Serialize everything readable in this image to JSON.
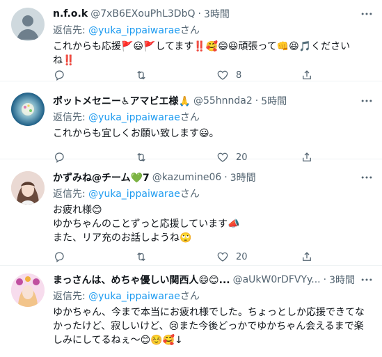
{
  "tweets": [
    {
      "name": "n.f.o.k",
      "handle": "@7xB6EXouPhL3DbQ",
      "time": "3時間",
      "reply_prefix": "返信先: ",
      "reply_to": "@yuka_ippaiwarae",
      "reply_suffix": "さん",
      "body": "これからも応援🚩😃🚩してます‼️🥰😄😆頑張って👊😆🎵くださいね‼️",
      "reply_count": "",
      "retweet_count": "",
      "like_count": "8"
    },
    {
      "name": "ポットメセニー♿アマビエ様🙏",
      "handle": "@55hnnda2",
      "time": "5時間",
      "reply_prefix": "返信先: ",
      "reply_to": "@yuka_ippaiwarae",
      "reply_suffix": "さん",
      "body": "これからも宜しくお願い致します😃。",
      "reply_count": "",
      "retweet_count": "",
      "like_count": "20"
    },
    {
      "name": "かずみね@チーム💚7",
      "handle": "@kazumine06",
      "time": "3時間",
      "reply_prefix": "返信先: ",
      "reply_to": "@yuka_ippaiwarae",
      "reply_suffix": "さん",
      "body": "お疲れ様😊\nゆかちゃんのことずっと応援しています📣\nまた、リア充のお話しようね🙄",
      "reply_count": "",
      "retweet_count": "",
      "like_count": "20"
    },
    {
      "name": "まっさんは、めちゃ優しい関西人😄😊...",
      "handle": "@aUkW0rDFVYy...",
      "time": "3時間",
      "reply_prefix": "返信先: ",
      "reply_to": "@yuka_ippaiwarae",
      "reply_suffix": "さん",
      "body": "ゆかちゃん、今まで本当にお疲れ様でした。ちょっとしか応援できてなかったけど、寂しいけど、😢また今後どっかでゆかちゃん会えるまで楽しみにしてるねぇ〜😊☺️🥰↓"
    }
  ],
  "separator": "·",
  "icons": {
    "more": "more-dots-icon",
    "reply": "reply-icon",
    "retweet": "retweet-icon",
    "like": "heart-icon",
    "share": "share-icon"
  }
}
